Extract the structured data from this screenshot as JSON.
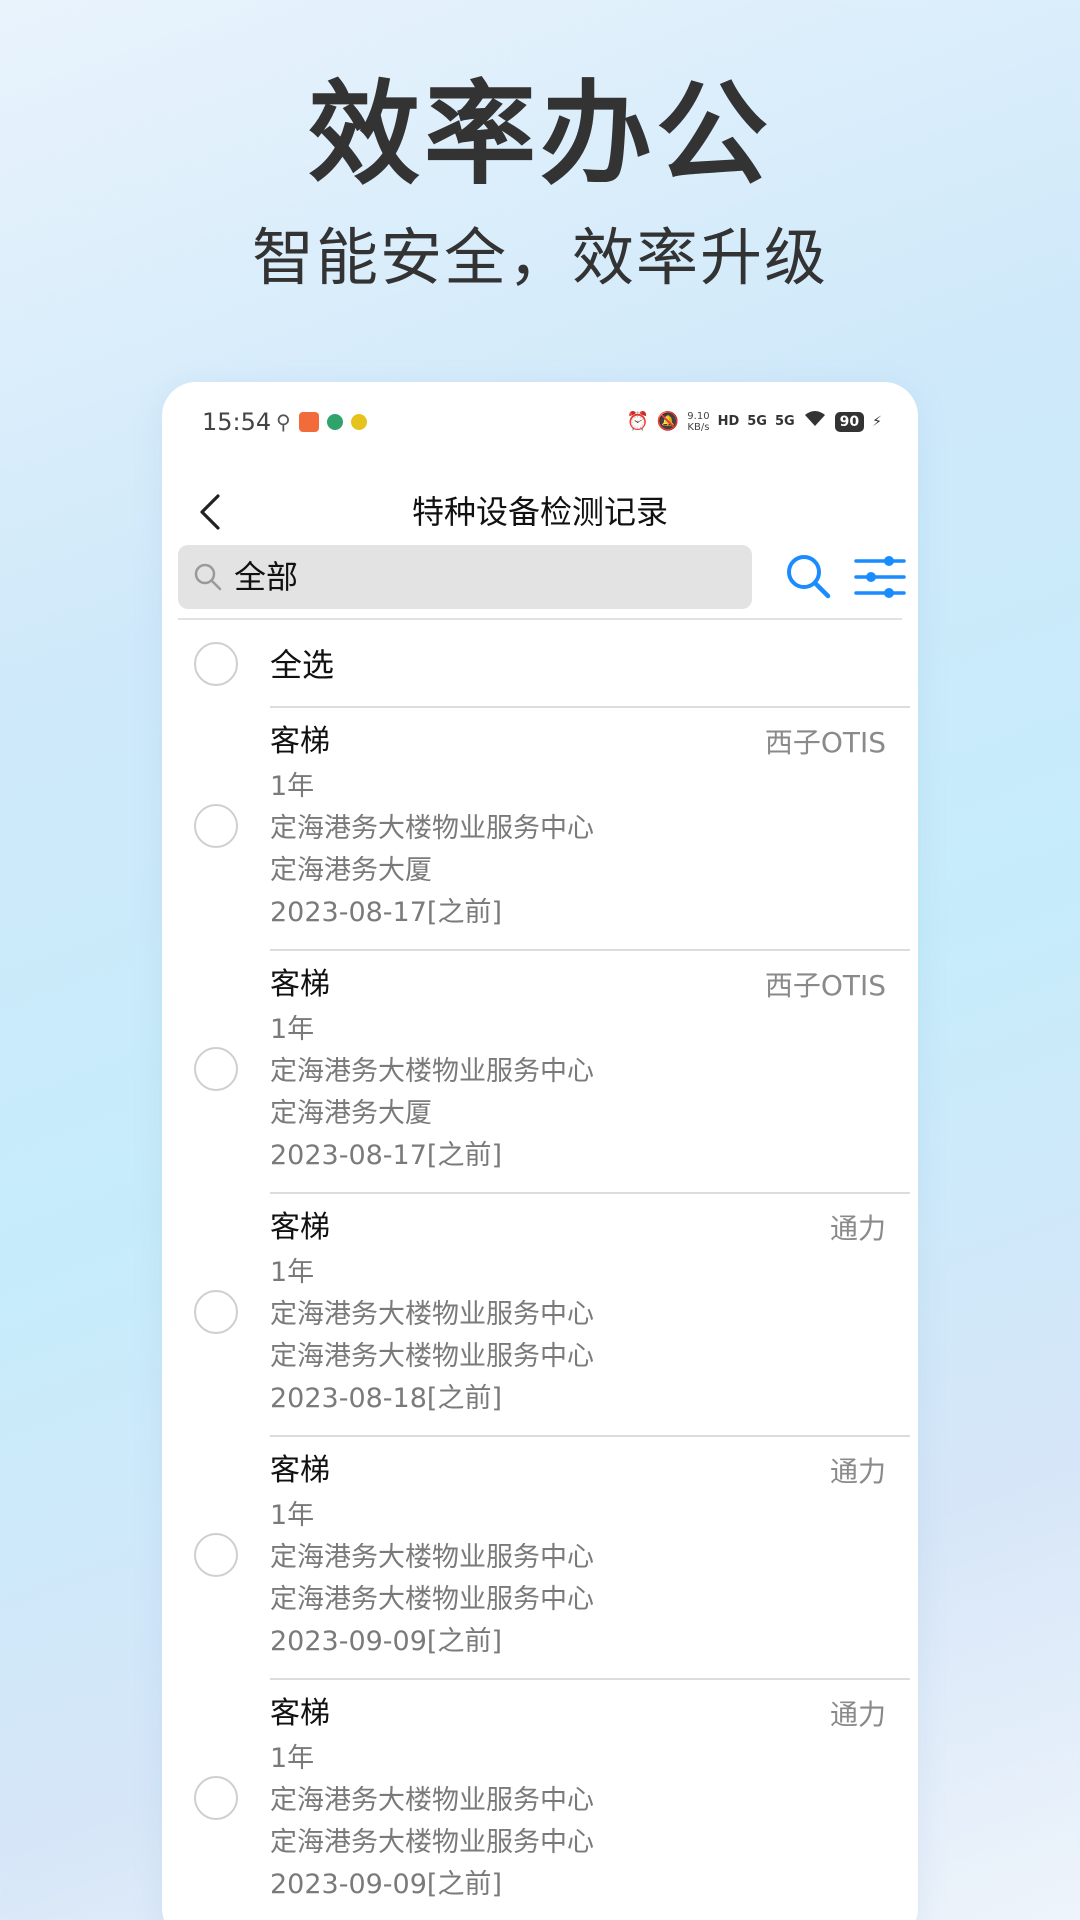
{
  "hero": {
    "title": "效率办公",
    "subtitle": "智能安全，效率升级"
  },
  "statusbar": {
    "time": "15:54",
    "net_speed_value": "9.10",
    "net_speed_unit": "KB/s",
    "hd_label": "HD",
    "signal1": "5G",
    "signal2": "5G",
    "battery": "90"
  },
  "nav": {
    "title": "特种设备检测记录"
  },
  "search": {
    "value": "全部"
  },
  "select_all": {
    "label": "全选"
  },
  "records": [
    {
      "type": "客梯",
      "brand": "西子OTIS",
      "period": "1年",
      "org": "定海港务大楼物业服务中心",
      "location": "定海港务大厦",
      "date": "2023-08-17[之前]"
    },
    {
      "type": "客梯",
      "brand": "西子OTIS",
      "period": "1年",
      "org": "定海港务大楼物业服务中心",
      "location": "定海港务大厦",
      "date": "2023-08-17[之前]"
    },
    {
      "type": "客梯",
      "brand": "通力",
      "period": "1年",
      "org": "定海港务大楼物业服务中心",
      "location": "定海港务大楼物业服务中心",
      "date": "2023-08-18[之前]"
    },
    {
      "type": "客梯",
      "brand": "通力",
      "period": "1年",
      "org": "定海港务大楼物业服务中心",
      "location": "定海港务大楼物业服务中心",
      "date": "2023-09-09[之前]"
    },
    {
      "type": "客梯",
      "brand": "通力",
      "period": "1年",
      "org": "定海港务大楼物业服务中心",
      "location": "定海港务大楼物业服务中心",
      "date": "2023-09-09[之前]"
    }
  ],
  "colors": {
    "accent": "#1a8cff",
    "title_text": "#333333",
    "secondary_text": "#7a7a7a"
  }
}
